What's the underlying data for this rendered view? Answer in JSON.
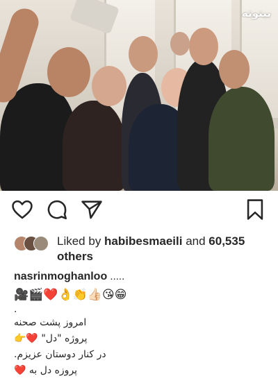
{
  "photo": {
    "watermark": "بیتوته",
    "description_icon": "group-selfie-photo"
  },
  "actions": {
    "like_icon": "heart-icon",
    "comment_icon": "comment-icon",
    "share_icon": "paper-plane-icon",
    "save_icon": "bookmark-icon"
  },
  "likes": {
    "prefix": "Liked by ",
    "user": "habibesmaeili",
    "middle": " and ",
    "count": "60,535",
    "suffix": "others"
  },
  "caption": {
    "username": "nasrinmoghanloo",
    "ellipsis": " .....",
    "emoji_line": "🎥🎬❤️👌👏👍🏻😘😁",
    "dot_line": ".",
    "line1": "امروز پشت صحنه",
    "line2": "پروژه \"دل\" ❤️👉",
    "line3": "در کنار دوستان عزیزم.",
    "line4": "پروزه دل به ❤️"
  },
  "colors": {
    "text": "#262626",
    "background": "#ffffff",
    "heart_red": "#ed4956"
  }
}
